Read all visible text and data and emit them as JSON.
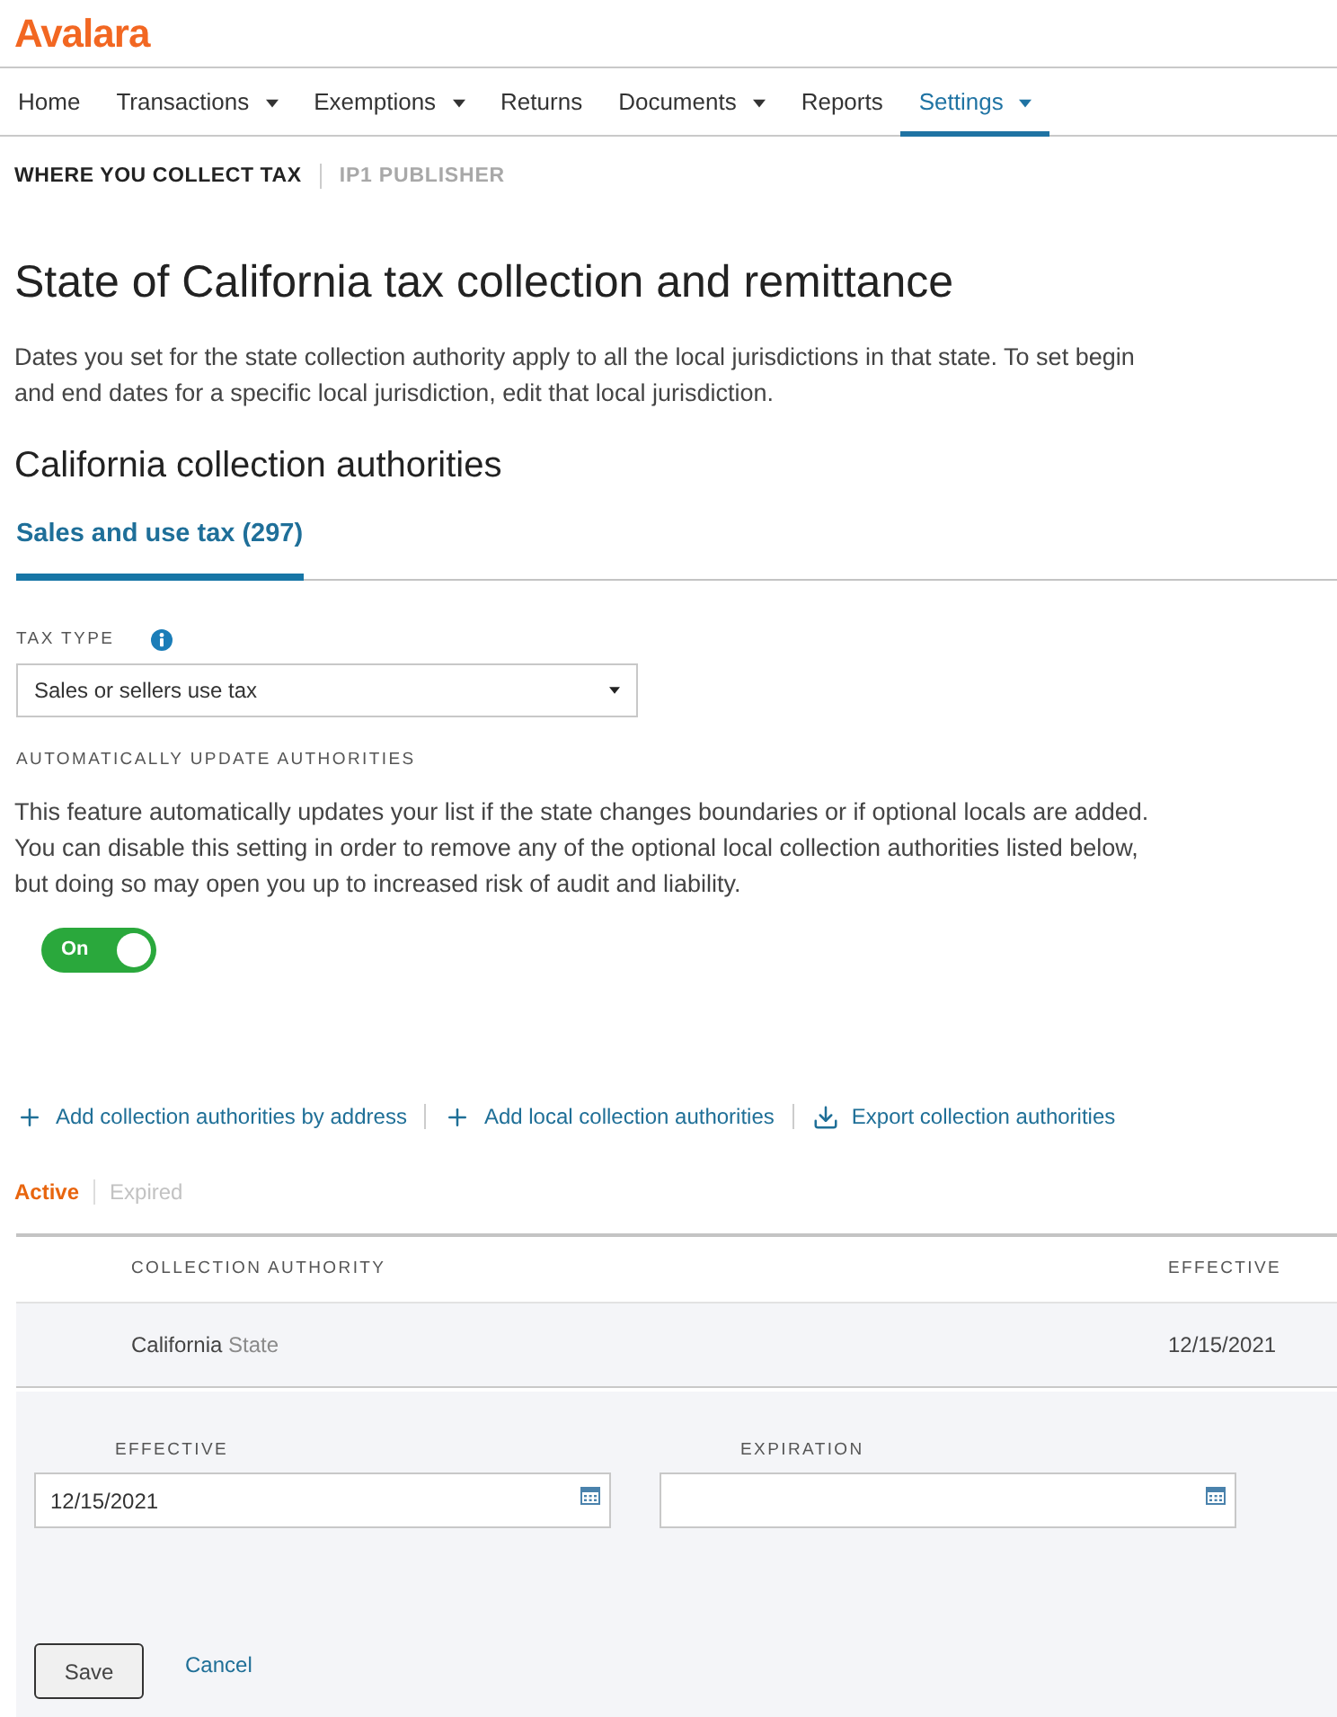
{
  "logo": {
    "text": "Avalara"
  },
  "nav": [
    {
      "label": "Home",
      "dropdown": false,
      "selected": false
    },
    {
      "label": "Transactions",
      "dropdown": true,
      "selected": false
    },
    {
      "label": "Exemptions",
      "dropdown": true,
      "selected": false
    },
    {
      "label": "Returns",
      "dropdown": false,
      "selected": false
    },
    {
      "label": "Documents",
      "dropdown": true,
      "selected": false
    },
    {
      "label": "Reports",
      "dropdown": false,
      "selected": false
    },
    {
      "label": "Settings",
      "dropdown": true,
      "selected": true
    }
  ],
  "breadcrumb": {
    "title": "WHERE YOU COLLECT TAX",
    "context": "IP1 PUBLISHER"
  },
  "page_title": "State of California tax collection and remittance",
  "intro": "Dates you set for the state collection authority apply to all the local jurisdictions in that state. To set begin and end dates for a specific local jurisdiction, edit that local jurisdiction.",
  "section_title": "California collection authorities",
  "tabs": [
    {
      "label": "Sales and use tax (297)",
      "selected": true
    }
  ],
  "tax_type": {
    "label": "TAX TYPE",
    "value": "Sales or sellers use tax"
  },
  "auto_update": {
    "label": "AUTOMATICALLY UPDATE AUTHORITIES",
    "description": "This feature automatically updates your list if the state changes boundaries or if optional locals are added. You can disable this setting in order to remove any of the optional local collection authorities listed below, but doing so may open you up to increased risk of audit and liability.",
    "toggle": {
      "label": "On",
      "on": true
    }
  },
  "actions": [
    {
      "kind": "add",
      "label": "Add collection authorities by address"
    },
    {
      "kind": "add",
      "label": "Add local collection authorities"
    },
    {
      "kind": "export",
      "label": "Export collection authorities"
    }
  ],
  "status_filters": [
    {
      "label": "Active",
      "selected": true
    },
    {
      "label": "Expired",
      "selected": false
    }
  ],
  "table": {
    "columns": [
      "COLLECTION AUTHORITY",
      "EFFECTIVE"
    ],
    "rows": [
      {
        "name": "California",
        "type": "State",
        "effective": "12/15/2021",
        "expanded": true
      }
    ]
  },
  "edit_panel": {
    "fields": [
      {
        "label": "EFFECTIVE",
        "value": "12/15/2021"
      },
      {
        "label": "EXPIRATION"
      }
    ],
    "save": "Save",
    "cancel": "Cancel"
  }
}
